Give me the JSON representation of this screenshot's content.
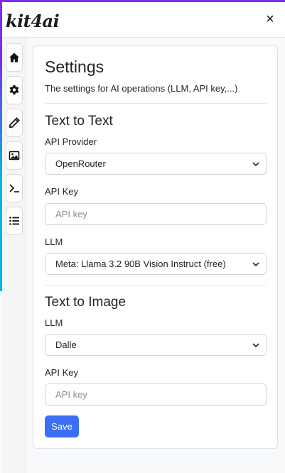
{
  "app": {
    "logo": "kit4ai",
    "close_icon": "close-icon",
    "close_glyph": "×"
  },
  "sidebar": {
    "items": [
      {
        "name": "home",
        "icon": "home-icon"
      },
      {
        "name": "settings",
        "icon": "gear-icon"
      },
      {
        "name": "edit",
        "icon": "pencil-icon"
      },
      {
        "name": "image",
        "icon": "image-icon"
      },
      {
        "name": "terminal",
        "icon": "terminal-icon"
      },
      {
        "name": "list",
        "icon": "list-icon"
      }
    ]
  },
  "settings": {
    "title": "Settings",
    "subtitle": "The settings for AI operations (LLM, API key,...)",
    "text_to_text": {
      "heading": "Text to Text",
      "provider_label": "API Provider",
      "provider_value": "OpenRouter",
      "api_key_label": "API Key",
      "api_key_placeholder": "API key",
      "llm_label": "LLM",
      "llm_value": "Meta: Llama 3.2 90B Vision Instruct (free)"
    },
    "text_to_image": {
      "heading": "Text to Image",
      "llm_label": "LLM",
      "llm_value": "Dalle",
      "api_key_label": "API Key",
      "api_key_placeholder": "API key"
    },
    "save_label": "Save"
  },
  "colors": {
    "accent": "#3b6ff5",
    "brand_purple": "#7b2cf0",
    "brand_cyan": "#00b5e2"
  }
}
